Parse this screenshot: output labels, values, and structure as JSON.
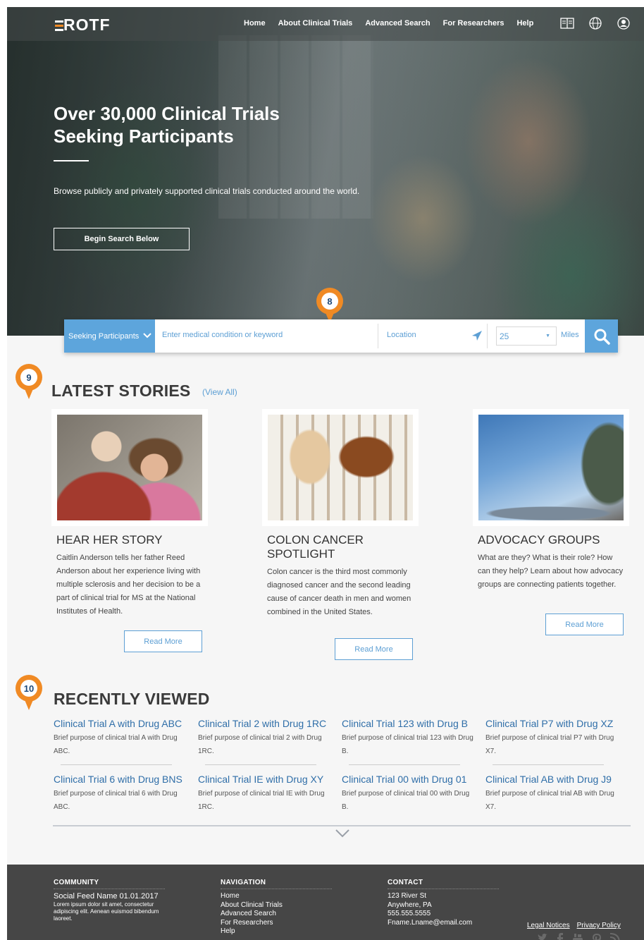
{
  "nav": {
    "logo": "ROTF",
    "links": [
      "Home",
      "About Clinical Trials",
      "Advanced Search",
      "For Researchers",
      "Help"
    ],
    "icons": [
      "book-icon",
      "globe-icon",
      "user-icon"
    ]
  },
  "hero": {
    "title_line1": "Over 30,000 Clinical Trials",
    "title_line2": "Seeking Participants",
    "subtitle": "Browse publicly and privately supported clinical trials conducted around the world.",
    "button": "Begin Search Below"
  },
  "search": {
    "filter": "Seeking Participants",
    "keyword_placeholder": "Enter medical condition or keyword",
    "location_placeholder": "Location",
    "distance": "25",
    "unit": "Miles"
  },
  "markers": [
    "8",
    "9",
    "10"
  ],
  "stories": {
    "title": "LATEST STORIES",
    "view_all": "(View All)",
    "items": [
      {
        "title": "HEAR HER STORY",
        "body": "Caitlin Anderson tells her father Reed Anderson about her experience living with multiple sclerosis and her decision to be a part of clinical trial for MS at the National Institutes of Health.",
        "button": "Read More"
      },
      {
        "title": "COLON CANCER SPOTLIGHT",
        "body": "Colon cancer is the third most commonly diagnosed cancer and the second leading cause of cancer death in men and women combined in the United States.",
        "button": "Read More"
      },
      {
        "title": "ADVOCACY GROUPS",
        "body": "What are they? What is their role? How can they help? Learn about how advocacy groups are connecting patients together.",
        "button": "Read More"
      }
    ]
  },
  "recent": {
    "title": "RECENTLY VIEWED",
    "items": [
      {
        "title": "Clinical Trial A with Drug ABC",
        "desc": "Brief purpose of clinical trial A with Drug ABC."
      },
      {
        "title": "Clinical Trial 2 with Drug 1RC",
        "desc": "Brief purpose of clinical trial 2 with Drug 1RC."
      },
      {
        "title": "Clinical Trial 123 with Drug B",
        "desc": "Brief purpose of clinical trial 123 with Drug B."
      },
      {
        "title": "Clinical Trial P7 with Drug XZ",
        "desc": "Brief purpose of clinical trial P7 with Drug X7."
      },
      {
        "title": "Clinical Trial 6 with Drug BNS",
        "desc": "Brief purpose of clinical trial 6 with Drug ABC."
      },
      {
        "title": "Clinical Trial IE with Drug XY",
        "desc": "Brief purpose of clinical trial IE with Drug 1RC."
      },
      {
        "title": "Clinical Trial 00 with Drug 01",
        "desc": "Brief purpose of clinical trial 00 with Drug B."
      },
      {
        "title": "Clinical Trial AB with Drug J9",
        "desc": "Brief purpose of clinical trial AB with Drug X7."
      }
    ]
  },
  "footer": {
    "community": {
      "heading": "COMMUNITY",
      "feed": "Social Feed Name   01.01.2017",
      "text": "Lorem ipsum dolor sit amet, consectetur adipiscing elit. Aenean euismod bibendum laoreet."
    },
    "navigation": {
      "heading": "NAVIGATION",
      "links": [
        "Home",
        "About Clinical Trials",
        "Advanced Search",
        "For Researchers",
        "Help"
      ]
    },
    "contact": {
      "heading": "CONTACT",
      "lines": [
        "123 River St",
        "Anywhere, PA",
        "555.555.5555",
        "Fname.Lname@email.com"
      ]
    },
    "legal": [
      "Legal Notices",
      "Privacy Policy"
    ],
    "social_icons": [
      "twitter-icon",
      "facebook-icon",
      "youtube-icon",
      "pinterest-icon",
      "rss-icon"
    ]
  },
  "colors": {
    "accent_blue": "#5da5dc",
    "link_blue": "#2f6ea8",
    "marker_orange": "#f08a24",
    "footer_bg": "#464646"
  }
}
